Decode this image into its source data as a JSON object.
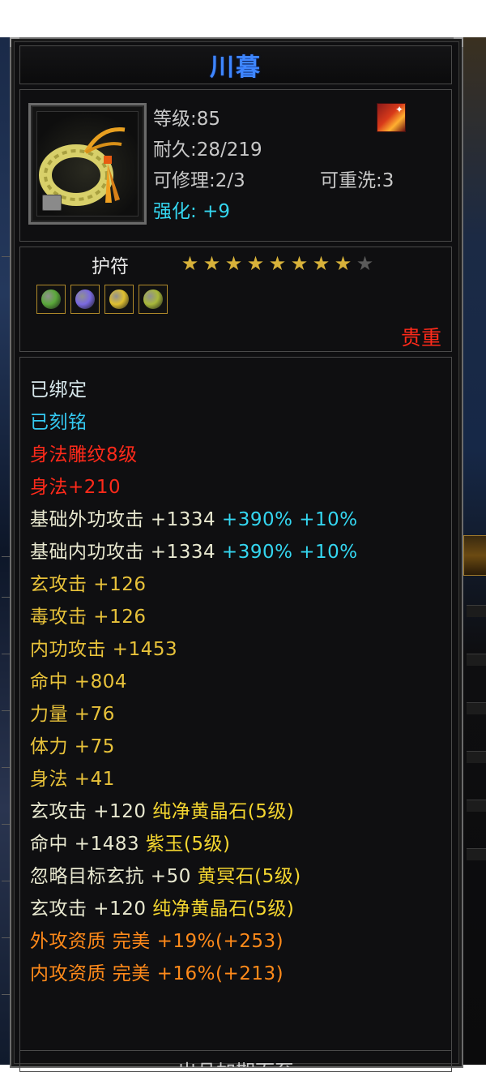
{
  "item": {
    "name": "川暮",
    "level_label": "等级:85",
    "durability_label": "耐久:28/219",
    "repairable_label": "可修理:2/3",
    "rewash_label": "可重洗:3",
    "enhance_label": "强化:",
    "enhance_value": "+9",
    "type": "护符",
    "stars_total": 9,
    "stars_filled": 8,
    "rarity": "贵重"
  },
  "slots": [
    {
      "icon": "green-gem-icon",
      "color": "#5aa83a"
    },
    {
      "icon": "purple-gem-icon",
      "color": "#7a6ae0"
    },
    {
      "icon": "yellow-gem-icon",
      "color": "#e0c030"
    },
    {
      "icon": "green-gold-gem-icon",
      "color": "#a8b83a"
    }
  ],
  "attributes": [
    {
      "text": "已绑定",
      "color": "white"
    },
    {
      "text": "已刻铭",
      "color": "cyan"
    },
    {
      "text": "身法雕纹8级",
      "color": "red"
    },
    {
      "text": "身法+210",
      "color": "red"
    },
    {
      "text": "基础外功攻击 +1334",
      "extra": " +390% +10%",
      "color": "stat"
    },
    {
      "text": "基础内功攻击 +1334",
      "extra": " +390% +10%",
      "color": "stat"
    },
    {
      "text": "玄攻击 +126",
      "color": "yellow"
    },
    {
      "text": "毒攻击 +126",
      "color": "yellow"
    },
    {
      "text": "内功攻击 +1453",
      "color": "yellow"
    },
    {
      "text": "命中 +804",
      "color": "yellow"
    },
    {
      "text": "力量 +76",
      "color": "yellow"
    },
    {
      "text": "体力 +75",
      "color": "yellow"
    },
    {
      "text": "身法 +41",
      "color": "yellow"
    },
    {
      "text": "玄攻击 +120",
      "gem": " 纯净黄晶石(5级)",
      "color": "stat"
    },
    {
      "text": "命中 +1483",
      "gem": " 紫玉(5级)",
      "color": "stat"
    },
    {
      "text": "忽略目标玄抗 +50",
      "gem": " 黄冥石(5级)",
      "color": "stat"
    },
    {
      "text": "玄攻击 +120",
      "gem": " 纯净黄晶石(5级)",
      "color": "stat"
    },
    {
      "text": "外攻资质  完美 +19%(+253)",
      "color": "orange"
    },
    {
      "text": "内攻资质  完美 +16%(+213)",
      "color": "orange"
    }
  ],
  "footer": "出品加期而至",
  "colors": {
    "title": "#3e86ff",
    "cyan": "#34d6f0",
    "red": "#ff2a1a",
    "yellow": "#e8c23a",
    "orange": "#ff8a1a",
    "gem_name": "#f4d630",
    "star": "#d8b23a"
  }
}
